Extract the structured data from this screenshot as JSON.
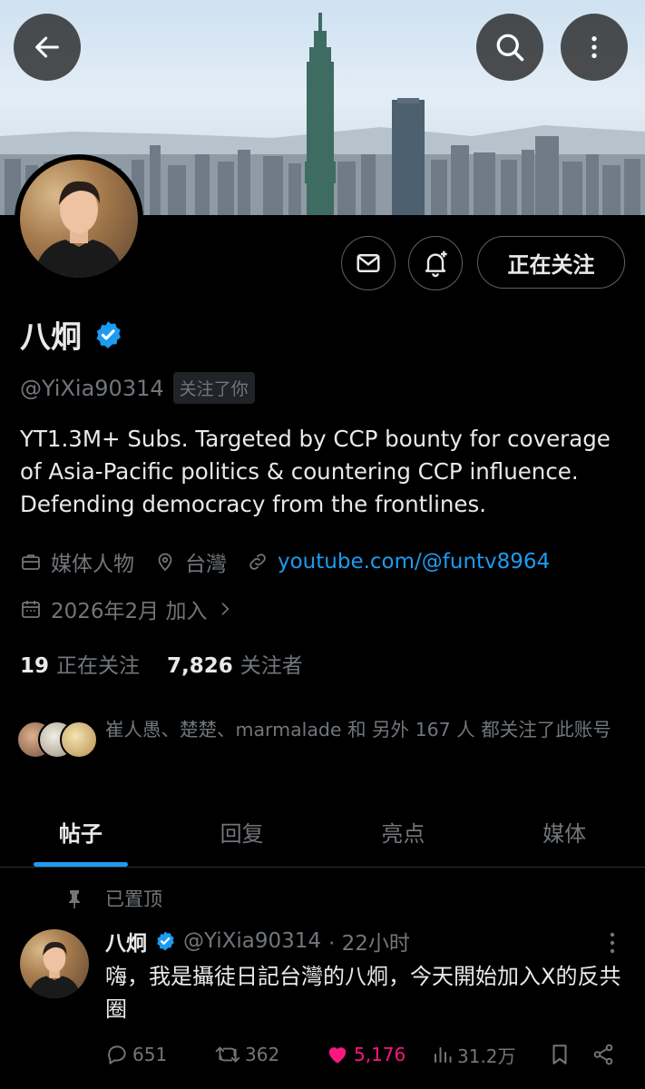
{
  "header": {
    "back_icon": "arrow-left-icon",
    "search_icon": "search-icon",
    "more_icon": "more-vertical-icon"
  },
  "profile": {
    "name": "八炯",
    "verified": true,
    "handle": "@YiXia90314",
    "follows_you": "关注了你",
    "follow_button": "正在关注",
    "bio": "YT1.3M+ Subs. Targeted by CCP bounty for coverage of Asia-Pacific politics & countering CCP influence. Defending democracy from the frontlines.",
    "category": "媒体人物",
    "location": "台灣",
    "website": "youtube.com/@funtv8964",
    "joined": "2026年2月 加入",
    "following_count": "19",
    "following_label": "正在关注",
    "followers_count": "7,826",
    "followers_label": "关注者",
    "mutual_followers": "崔人愚、楚楚、marmalade 和 另外 167 人 都关注了此账号"
  },
  "tabs": [
    {
      "label": "帖子",
      "active": true
    },
    {
      "label": "回复",
      "active": false
    },
    {
      "label": "亮点",
      "active": false
    },
    {
      "label": "媒体",
      "active": false
    }
  ],
  "pinned_tweet": {
    "pinned_label": "已置顶",
    "author_name": "八炯",
    "author_handle": "@YiXia90314",
    "time": "· 22小时",
    "text": "嗨，我是攝徒日記台灣的八炯，今天開始加入X的反共圈",
    "replies": "651",
    "reposts": "362",
    "likes": "5,176",
    "views": "31.2万"
  },
  "colors": {
    "accent": "#1d9bf0",
    "like": "#f91880",
    "muted": "#71767b",
    "background": "#000000"
  }
}
